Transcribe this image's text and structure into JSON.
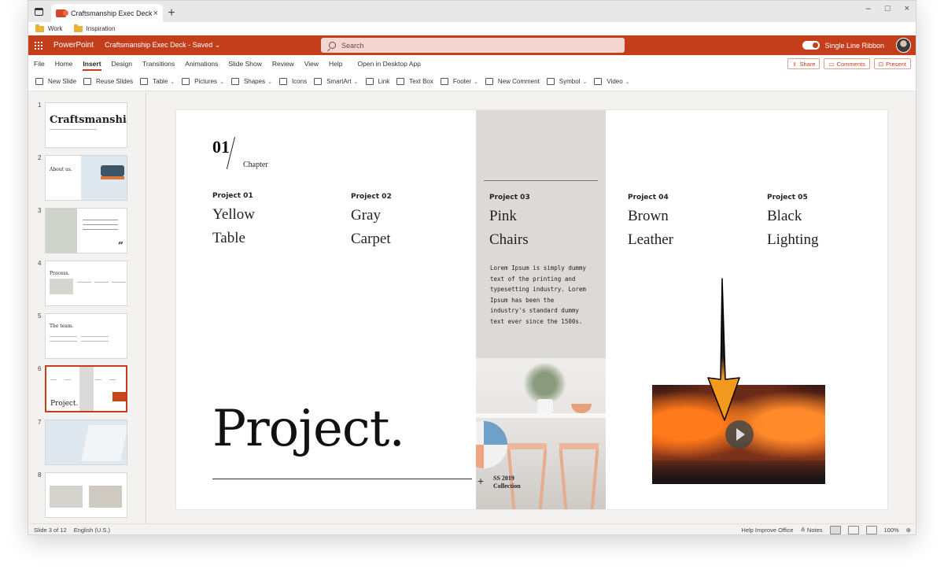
{
  "browser": {
    "tab_title": "Craftsmanship Exec Deck",
    "tab_close": "×",
    "new_tab": "+",
    "window_controls": [
      "–",
      "□",
      "×"
    ],
    "bookmarks": [
      "Work",
      "Inspiration"
    ]
  },
  "app": {
    "name": "PowerPoint",
    "document": "Craftsmanship Exec Deck - Saved ⌄",
    "search_placeholder": "Search",
    "single_line_ribbon": "Single Line Ribbon",
    "accent_color": "#c43e1c"
  },
  "menu": {
    "tabs": [
      "File",
      "Home",
      "Insert",
      "Design",
      "Transitions",
      "Animations",
      "Slide Show",
      "Review",
      "View",
      "Help"
    ],
    "active": "Insert",
    "open_desktop": "Open in Desktop App",
    "share": "Share",
    "comments": "Comments",
    "present": "Present"
  },
  "ribbon": {
    "items": [
      {
        "label": "New Slide",
        "chev": false
      },
      {
        "label": "Reuse Slides",
        "chev": false
      },
      {
        "label": "Table",
        "chev": true
      },
      {
        "label": "Pictures",
        "chev": true
      },
      {
        "label": "Shapes",
        "chev": true
      },
      {
        "label": "Icons",
        "chev": false
      },
      {
        "label": "SmartArt",
        "chev": true
      },
      {
        "label": "Link",
        "chev": false
      },
      {
        "label": "Text Box",
        "chev": false
      },
      {
        "label": "Footer",
        "chev": true
      },
      {
        "label": "New Comment",
        "chev": false
      },
      {
        "label": "Symbol",
        "chev": true
      },
      {
        "label": "Video",
        "chev": true
      }
    ]
  },
  "thumbnails": [
    {
      "num": "1",
      "title": "Craftsmanship."
    },
    {
      "num": "2",
      "title": "About us."
    },
    {
      "num": "3",
      "title": "”"
    },
    {
      "num": "4",
      "title": "Process."
    },
    {
      "num": "5",
      "title": "The team."
    },
    {
      "num": "6",
      "title": "Project."
    },
    {
      "num": "7",
      "title": ""
    },
    {
      "num": "8",
      "title": ""
    }
  ],
  "slide": {
    "chapter_number": "01",
    "chapter_label": "Chapter",
    "projects": [
      {
        "label": "Project 01",
        "name1": "Yellow",
        "name2": "Table"
      },
      {
        "label": "Project 02",
        "name1": "Gray",
        "name2": "Carpet"
      },
      {
        "label": "Project 03",
        "name1": "Pink",
        "name2": "Chairs"
      },
      {
        "label": "Project 04",
        "name1": "Brown",
        "name2": "Leather"
      },
      {
        "label": "Project 05",
        "name1": "Black",
        "name2": "Lighting"
      }
    ],
    "lorem": "Lorem Ipsum is simply dummy text of the printing and typesetting industry. Lorem Ipsum has been the industry's standard dummy text ever since the 1500s.",
    "collection_line1": "SS 2019",
    "collection_line2": "Collection",
    "title": "Project."
  },
  "status": {
    "slide_info": "Slide 3 of 12",
    "language": "English (U.S.)",
    "help": "Help Improve Office",
    "notes": "Notes",
    "zoom": "100%"
  }
}
